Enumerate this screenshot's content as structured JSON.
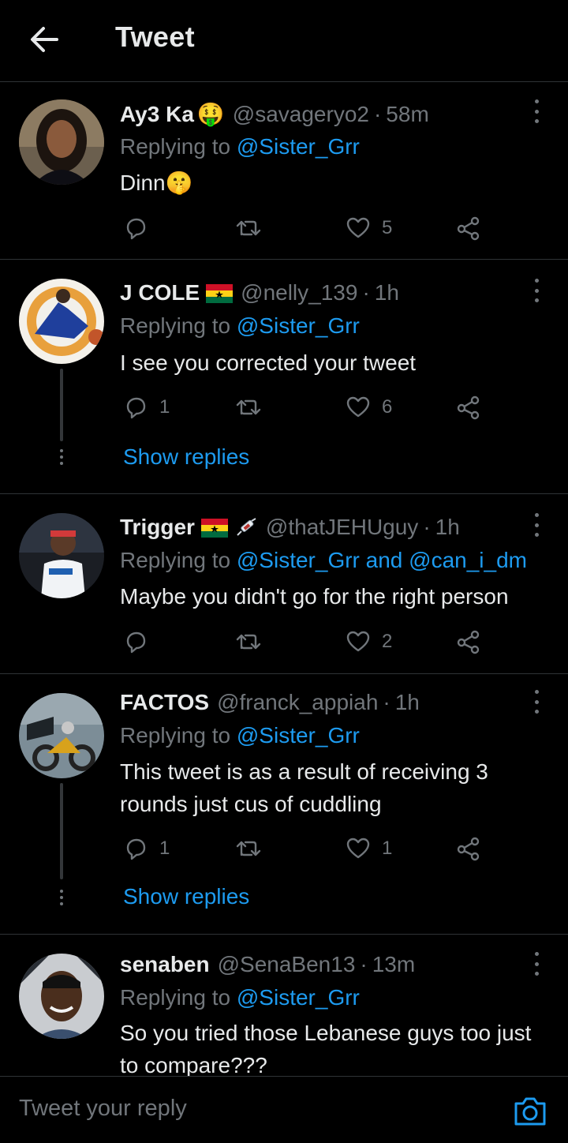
{
  "header": {
    "title": "Tweet",
    "back_icon": "arrow-left-icon"
  },
  "tweets": [
    {
      "name": "Ay3 Ka",
      "name_emoji": "🤑",
      "handle": "@savageryo2",
      "sep": "·",
      "time": "58m",
      "replying_prefix": "Replying to",
      "mentions": "@Sister_Grr",
      "text": "Dinn",
      "text_emoji": "🤫",
      "reply_count": "",
      "retweet_count": "",
      "like_count": "5"
    },
    {
      "name": "J COLE",
      "name_emoji": "🇬🇭",
      "handle": "@nelly_139",
      "sep": "·",
      "time": "1h",
      "replying_prefix": "Replying to",
      "mentions": "@Sister_Grr",
      "text": "I see you corrected your tweet",
      "reply_count": "1",
      "retweet_count": "",
      "like_count": "6",
      "show_replies": "Show replies"
    },
    {
      "name": "Trigger",
      "name_emoji": "🇬🇭💉",
      "handle": "@thatJEHUguy",
      "sep": "·",
      "time": "1h",
      "replying_prefix": "Replying to",
      "mentions": "@Sister_Grr and @can_i_dm",
      "text": "Maybe you didn't go for the right person",
      "reply_count": "",
      "retweet_count": "",
      "like_count": "2"
    },
    {
      "name": "FACTOS",
      "handle": "@franck_appiah",
      "sep": "·",
      "time": "1h",
      "replying_prefix": "Replying to",
      "mentions": "@Sister_Grr",
      "text": "This tweet is as a result of receiving 3 rounds just cus of cuddling",
      "reply_count": "1",
      "retweet_count": "",
      "like_count": "1",
      "show_replies": "Show replies"
    },
    {
      "name": "senaben",
      "handle": "@SenaBen13",
      "sep": "·",
      "time": "13m",
      "replying_prefix": "Replying to",
      "mentions": "@Sister_Grr",
      "text": "So you tried those Lebanese guys too just to compare???"
    }
  ],
  "reply_bar": {
    "placeholder": "Tweet your reply",
    "camera_icon": "camera-icon"
  },
  "colors": {
    "background": "#000000",
    "accent": "#1d9bf0",
    "muted": "#71767b",
    "text": "#e7e9ea",
    "divider": "#2f3336"
  }
}
